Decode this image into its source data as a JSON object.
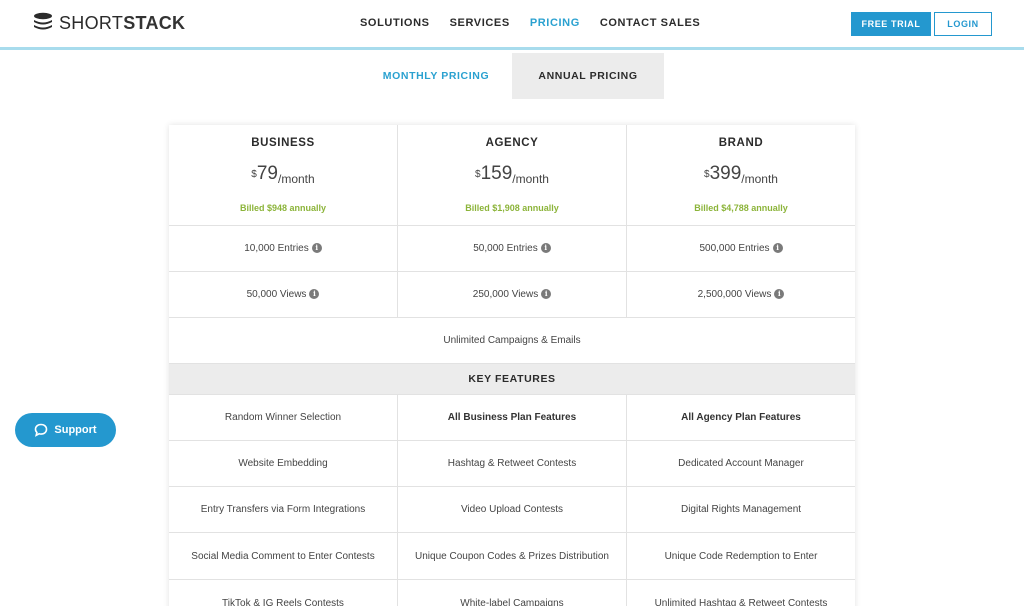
{
  "header": {
    "logo_light": "SHORT",
    "logo_bold": "STACK",
    "nav": [
      {
        "label": "SOLUTIONS",
        "active": false
      },
      {
        "label": "SERVICES",
        "active": false
      },
      {
        "label": "PRICING",
        "active": true
      },
      {
        "label": "CONTACT SALES",
        "active": false
      }
    ],
    "free_trial_label": "FREE TRIAL",
    "login_label": "LOGIN"
  },
  "tabs": {
    "monthly": "MONTHLY PRICING",
    "annual": "ANNUAL PRICING",
    "selected": "annual"
  },
  "plans": [
    {
      "name": "BUSINESS",
      "currency": "$",
      "amount": "79",
      "period": "/month",
      "billed": "Billed $948 annually",
      "entries": "10,000 Entries",
      "views": "50,000 Views"
    },
    {
      "name": "AGENCY",
      "currency": "$",
      "amount": "159",
      "period": "/month",
      "billed": "Billed $1,908 annually",
      "entries": "50,000 Entries",
      "views": "250,000 Views"
    },
    {
      "name": "BRAND",
      "currency": "$",
      "amount": "399",
      "period": "/month",
      "billed": "Billed $4,788 annually",
      "entries": "500,000 Entries",
      "views": "2,500,000 Views"
    }
  ],
  "unlimited": "Unlimited Campaigns & Emails",
  "key_features_title": "KEY FEATURES",
  "features": [
    [
      "Random Winner Selection",
      "All Business Plan Features",
      "All Agency Plan Features"
    ],
    [
      "Website Embedding",
      "Hashtag & Retweet Contests",
      "Dedicated Account Manager"
    ],
    [
      "Entry Transfers via Form Integrations",
      "Video Upload Contests",
      "Digital Rights Management"
    ],
    [
      "Social Media Comment to Enter Contests",
      "Unique Coupon Codes & Prizes Distribution",
      "Unique Code Redemption to Enter"
    ],
    [
      "TikTok & IG Reels Contests",
      "White-label Campaigns",
      "Unlimited Hashtag & Retweet Contests"
    ]
  ],
  "support_label": "Support",
  "colors": {
    "accent": "#2498cf",
    "billed_green": "#8cb43a",
    "header_rule": "#a8dced"
  }
}
